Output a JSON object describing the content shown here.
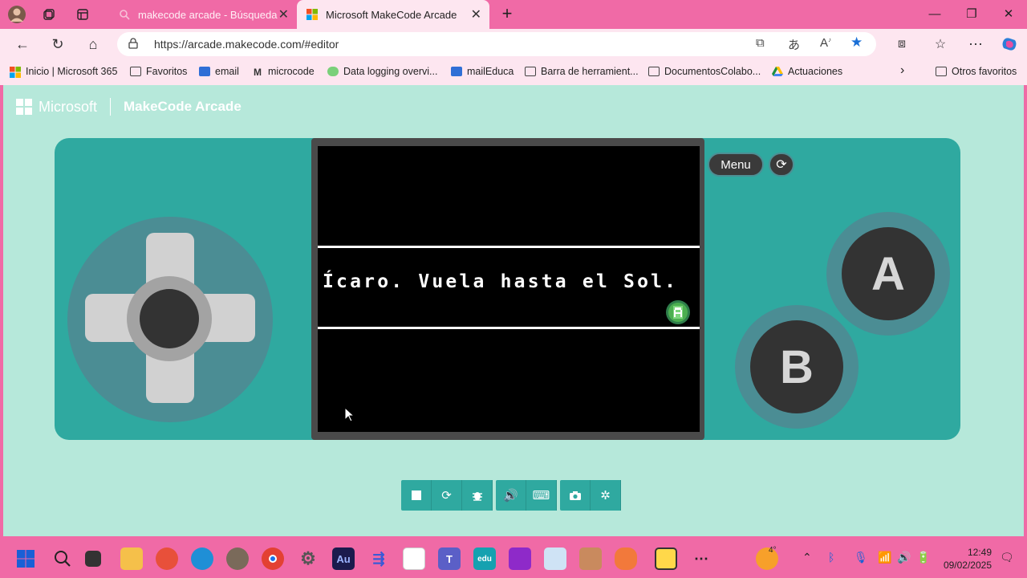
{
  "browser": {
    "tabs": [
      {
        "title": "makecode arcade - Búsqueda",
        "active": false
      },
      {
        "title": "Microsoft MakeCode Arcade",
        "active": true
      }
    ],
    "address": {
      "url": "https://arcade.makecode.com/#editor"
    }
  },
  "favorites": [
    {
      "label": "Inicio | Microsoft 365",
      "icon": "ms365-icon"
    },
    {
      "label": "Favoritos",
      "icon": "folder-icon"
    },
    {
      "label": "email",
      "icon": "mail-icon"
    },
    {
      "label": "microcode",
      "icon": "microcode-icon"
    },
    {
      "label": "Data logging overvi...",
      "icon": "data-logging-icon"
    },
    {
      "label": "mailEduca",
      "icon": "mail-icon"
    },
    {
      "label": "Barra de herramient...",
      "icon": "folder-icon"
    },
    {
      "label": "DocumentosColabo...",
      "icon": "folder-icon"
    },
    {
      "label": "Actuaciones",
      "icon": "drive-icon"
    }
  ],
  "favorites_other": "Otros favoritos",
  "app": {
    "brand": "Microsoft",
    "title": "MakeCode Arcade",
    "menu_label": "Menu",
    "game_text": "Ícaro. Vuela hasta el Sol.",
    "button_a": "A",
    "button_b": "B"
  },
  "toolbar": {
    "buttons": [
      "stop-icon",
      "restart-icon",
      "debug-icon",
      "sound-icon",
      "keyboard-icon",
      "screenshot-icon",
      "fullscreen-icon"
    ]
  },
  "taskbar": {
    "weather_temp": "4°",
    "time": "12:49",
    "date": "09/02/2025"
  },
  "colors": {
    "browser_frame": "#f06aa6",
    "page_bg": "#b6e8da",
    "console": "#2fa9a0",
    "ring": "#4b8d94"
  }
}
